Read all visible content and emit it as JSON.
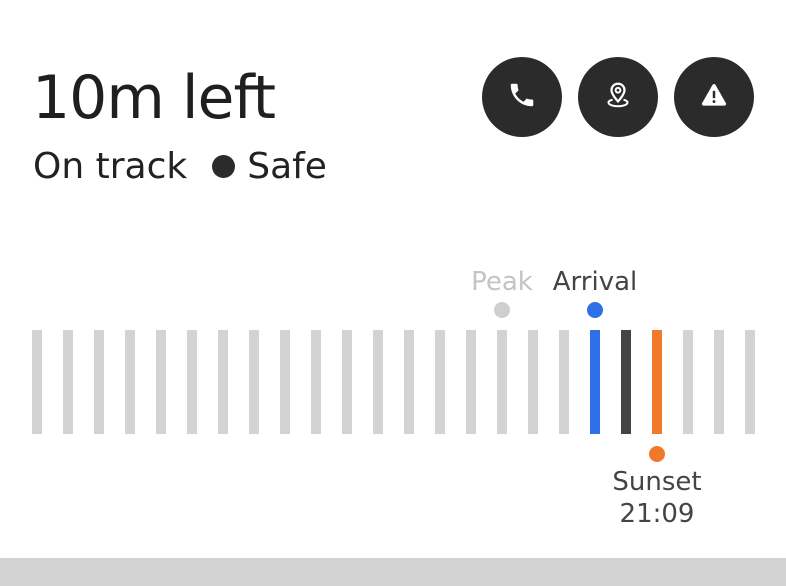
{
  "header": {
    "title": "10m left",
    "status": "On track",
    "safety": "Safe"
  },
  "actions": [
    {
      "name": "call-button",
      "icon": "phone-icon"
    },
    {
      "name": "share-location-button",
      "icon": "location-pin-icon"
    },
    {
      "name": "alert-button",
      "icon": "warning-icon"
    }
  ],
  "timeline": {
    "bar_count": 24,
    "markers": [
      {
        "key": "peak",
        "label": "Peak",
        "index": 15,
        "color": "#cfcfcf",
        "text_color": "#c4c4c4",
        "label_position": "above"
      },
      {
        "key": "arrival",
        "label": "Arrival",
        "index": 18,
        "color": "#2f6fe8",
        "text_color": "#444444",
        "label_position": "above"
      },
      {
        "key": "now",
        "label": "",
        "index": 19,
        "color": "#444444",
        "text_color": "#444444",
        "label_position": "none"
      },
      {
        "key": "sunset",
        "label": "Sunset",
        "time": "21:09",
        "index": 20,
        "color": "#f07a2a",
        "text_color": "#444444",
        "label_position": "below"
      }
    ]
  },
  "colors": {
    "button_bg": "#2b2b2b",
    "bar_default": "#d3d3d3",
    "arrival": "#2f6fe8",
    "sunset": "#f07a2a",
    "now": "#444444"
  }
}
